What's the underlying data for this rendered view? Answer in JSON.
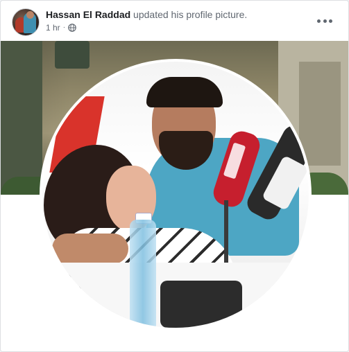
{
  "post": {
    "author": "Hassan El Raddad",
    "action_text": " updated his profile picture.",
    "timestamp": "1 hr",
    "separator": "·",
    "privacy_icon": "globe-icon",
    "more_icon": "more-options-icon"
  },
  "colors": {
    "author": "#1c1e21",
    "secondary_text": "#606770",
    "card_border": "#dddfe2",
    "page_background": "#f0f2f5"
  }
}
